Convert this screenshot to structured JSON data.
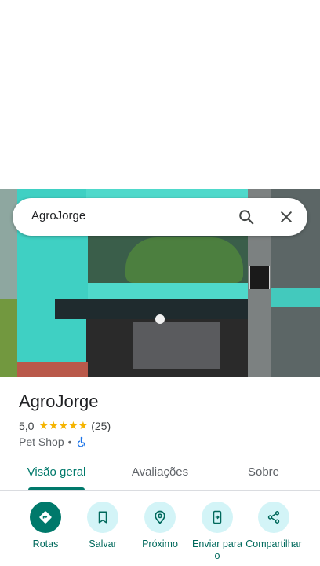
{
  "search": {
    "query": "AgroJorge",
    "search_icon": "search-icon",
    "close_icon": "close-icon"
  },
  "place": {
    "name": "AgroJorge",
    "rating": "5,0",
    "stars": "★★★★★",
    "review_count": "(25)",
    "category": "Pet Shop",
    "separator": "•",
    "accessibility_icon": "wheelchair-icon"
  },
  "tabs": [
    {
      "label": "Visão geral",
      "active": true
    },
    {
      "label": "Avaliações",
      "active": false
    },
    {
      "label": "Sobre",
      "active": false
    }
  ],
  "actions": [
    {
      "label": "Rotas",
      "icon": "directions-icon"
    },
    {
      "label": "Salvar",
      "icon": "bookmark-icon"
    },
    {
      "label": "Próximo",
      "icon": "nearby-icon"
    },
    {
      "label": "Enviar para o",
      "icon": "send-to-phone-icon"
    },
    {
      "label": "Compartilhar",
      "icon": "share-icon"
    }
  ],
  "colors": {
    "accent": "#00796b",
    "star": "#f5b400",
    "action_bg": "#d3f4f7"
  }
}
